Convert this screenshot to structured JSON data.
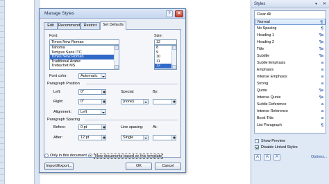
{
  "dialog": {
    "title": "Manage Styles",
    "help_glyph": "?",
    "close_glyph": "✕",
    "tabs": [
      "Edit",
      "Recommend",
      "Restrict",
      "Set Defaults"
    ],
    "font_label": "Font:",
    "font_value": "Times New Roman",
    "fonts": [
      "Tahoma",
      "Tempus Sans ITC",
      "Times New Roman",
      "Traditional Arabic",
      "Trebuchet MS"
    ],
    "size_label": "Size:",
    "size_value": "12",
    "sizes": [
      "8",
      "9",
      "10",
      "11",
      "12"
    ],
    "font_color_label": "Font color:",
    "font_color_value": "Automatic",
    "para_position_label": "Paragraph Position",
    "left_label": "Left:",
    "left_value": "0\"",
    "special_label": "Special:",
    "special_value": "(none)",
    "by_label": "By:",
    "right_label": "Right:",
    "right_value": "0\"",
    "alignment_label": "Alignment:",
    "alignment_value": "Left",
    "para_spacing_label": "Paragraph Spacing",
    "before_label": "Before:",
    "before_value": "0 pt",
    "line_spacing_label": "Line spacing:",
    "line_spacing_value": "Single",
    "at_label": "At:",
    "after_label": "After:",
    "after_value": "12 pt",
    "only_doc_label": "Only in this document",
    "new_docs_label": "New documents based on this template",
    "import_export_label": "Import/Export...",
    "ok_label": "OK",
    "cancel_label": "Cancel"
  },
  "styles_pane": {
    "title": "Styles",
    "controls": [
      "▾",
      "✕"
    ],
    "items": [
      {
        "name": "Clear All",
        "marker": ""
      },
      {
        "name": "Normal",
        "marker": "¶"
      },
      {
        "name": "No Spacing",
        "marker": "¶"
      },
      {
        "name": "Heading 1",
        "marker": "¶a"
      },
      {
        "name": "Heading 2",
        "marker": "¶a"
      },
      {
        "name": "Title",
        "marker": "¶a"
      },
      {
        "name": "Subtitle",
        "marker": "¶a"
      },
      {
        "name": "Subtle Emphasis",
        "marker": "a"
      },
      {
        "name": "Emphasis",
        "marker": "a"
      },
      {
        "name": "Intense Emphasis",
        "marker": "a"
      },
      {
        "name": "Strong",
        "marker": "a"
      },
      {
        "name": "Quote",
        "marker": "¶a"
      },
      {
        "name": "Intense Quote",
        "marker": "¶a"
      },
      {
        "name": "Subtle Reference",
        "marker": "a"
      },
      {
        "name": "Intense Reference",
        "marker": "a"
      },
      {
        "name": "Book Title",
        "marker": "a"
      },
      {
        "name": "List Paragraph",
        "marker": "¶"
      }
    ],
    "show_preview_label": "Show Preview",
    "disable_linked_label": "Disable Linked Styles",
    "options_label": "Options...",
    "icons": [
      "new-style-icon",
      "style-inspector-icon",
      "manage-styles-icon"
    ]
  }
}
